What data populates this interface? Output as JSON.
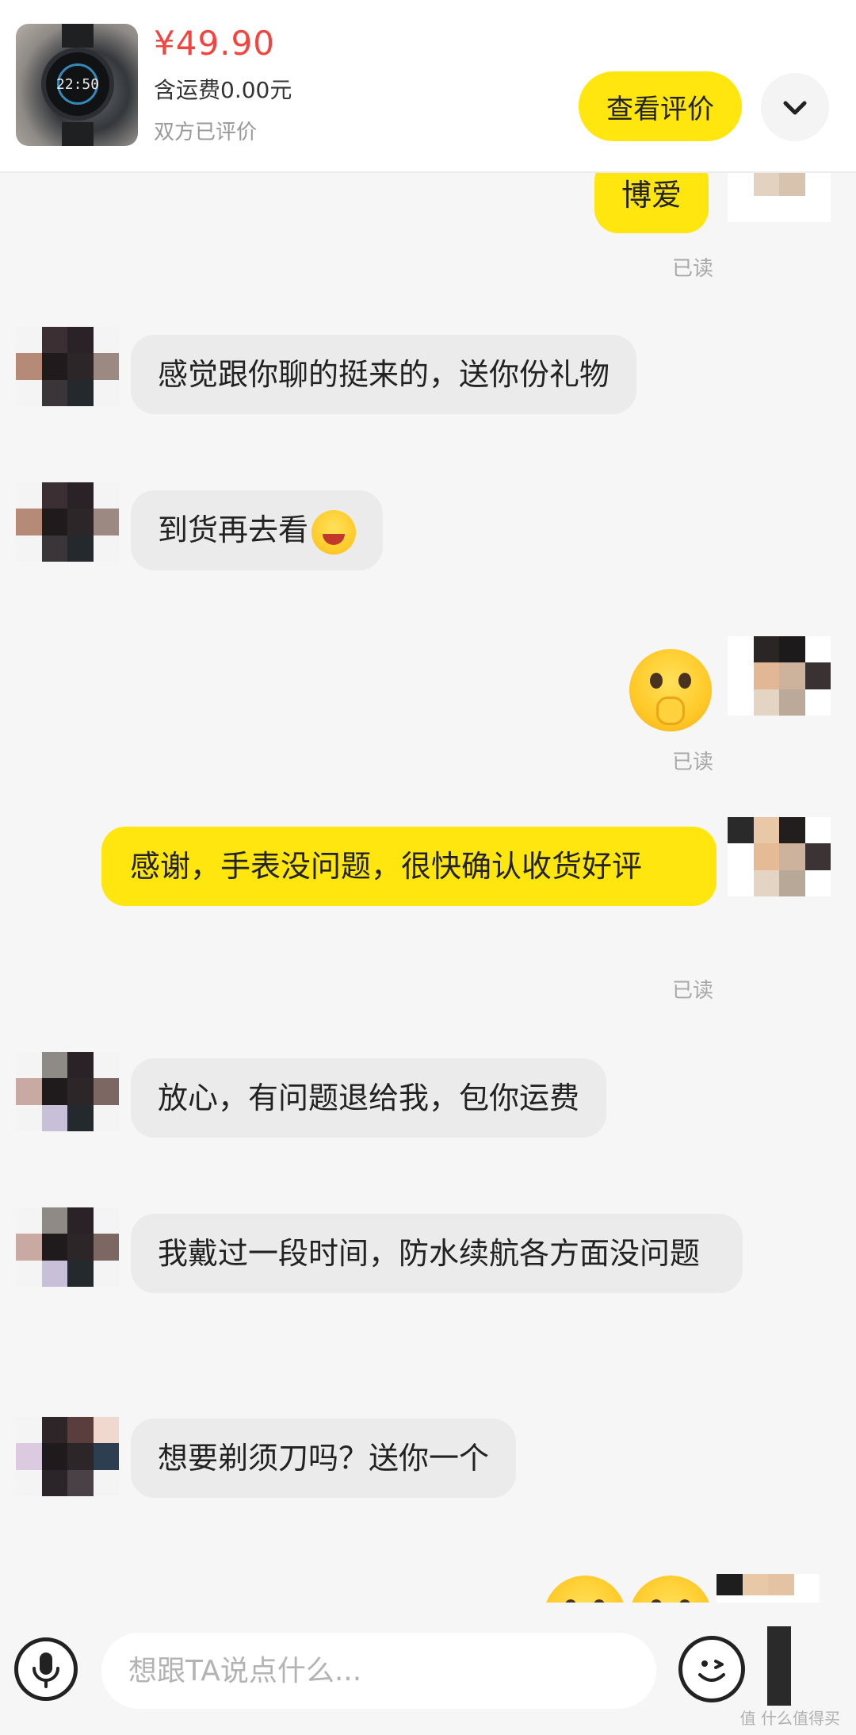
{
  "header": {
    "price": "¥49.90",
    "shipping": "含运费0.00元",
    "status": "双方已评价",
    "review_button": "查看评价",
    "thumbnail_time": "22:50",
    "more_icon": "chevron-down-icon"
  },
  "messages": [
    {
      "side": "out",
      "text": "博爱",
      "read": "已读"
    },
    {
      "side": "in",
      "text": "感觉跟你聊的挺来的，送你份礼物"
    },
    {
      "side": "in",
      "text": "到货再去看"
    },
    {
      "side": "out",
      "emoji": "shy-face-emoji",
      "read": "已读"
    },
    {
      "side": "out",
      "text": "感谢，手表没问题，很快确认收货好评",
      "read": "已读"
    },
    {
      "side": "in",
      "text": "放心，有问题退给我，包你运费"
    },
    {
      "side": "in",
      "text": "我戴过一段时间，防水续航各方面没问题"
    },
    {
      "side": "in",
      "text": "想要剃须刀吗？送你一个"
    },
    {
      "side": "out",
      "emoji": "shy-face-emoji-pair"
    }
  ],
  "input": {
    "placeholder": "想跟TA说点什么...",
    "mic_icon": "microphone-icon",
    "emoji_icon": "emoji-face-icon"
  },
  "watermark": "值 什么值得买",
  "colors": {
    "accent": "#ffe60f",
    "price": "#f2453f",
    "incoming_bubble": "#ebebeb",
    "read_text": "#a8a8a8"
  }
}
